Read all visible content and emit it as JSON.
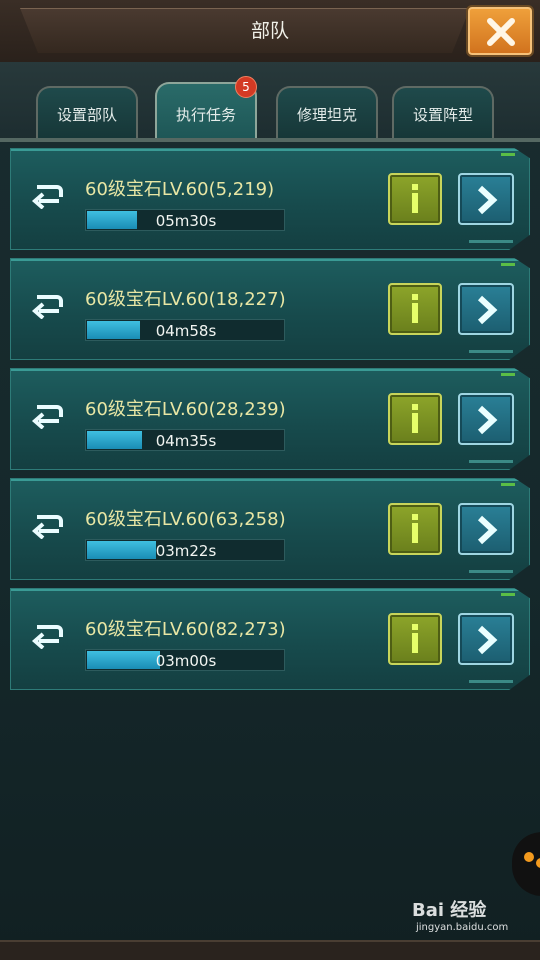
{
  "header": {
    "title": "部队",
    "close_icon": "close-icon"
  },
  "tabs": [
    {
      "label": "设置部队",
      "active": false
    },
    {
      "label": "执行任务",
      "active": true,
      "badge": "5"
    },
    {
      "label": "修理坦克",
      "active": false
    },
    {
      "label": "设置阵型",
      "active": false
    }
  ],
  "tasks": [
    {
      "title": "60级宝石LV.60(5,219)",
      "timer": "05m30s",
      "progress": 0.25
    },
    {
      "title": "60级宝石LV.60(18,227)",
      "timer": "04m58s",
      "progress": 0.27
    },
    {
      "title": "60级宝石LV.60(28,239)",
      "timer": "04m35s",
      "progress": 0.28
    },
    {
      "title": "60级宝石LV.60(63,258)",
      "timer": "03m22s",
      "progress": 0.35
    },
    {
      "title": "60级宝石LV.60(82,273)",
      "timer": "03m00s",
      "progress": 0.37
    }
  ],
  "watermark": {
    "main": "Bai 经验",
    "sub": "jingyan.baidu.com"
  },
  "colors": {
    "accent_teal": "#3fd6c3",
    "info_green": "#8da52a",
    "go_blue": "#2a8097",
    "close_orange": "#f0a23c",
    "title_yellow": "#e8e6a4"
  }
}
